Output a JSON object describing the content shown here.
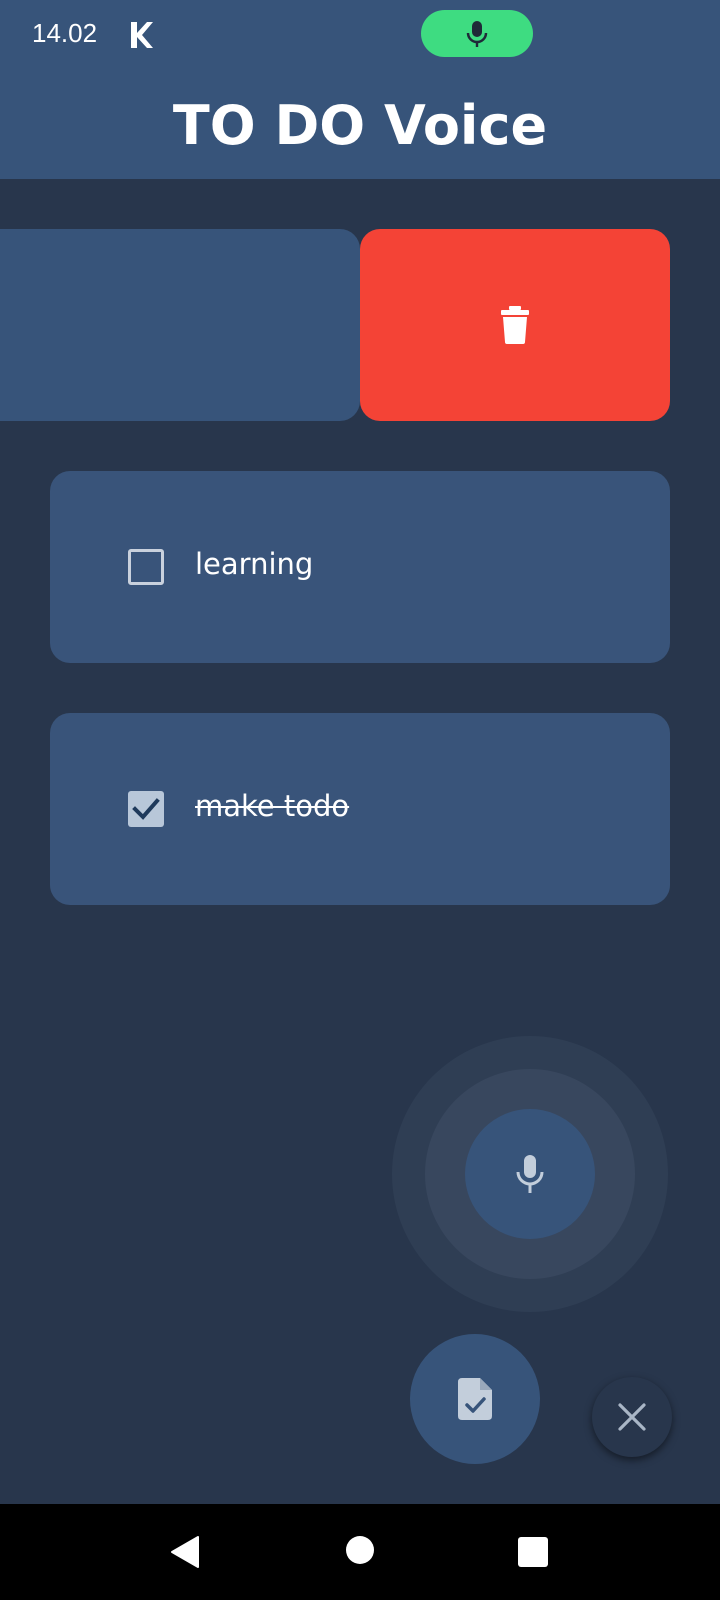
{
  "status_bar": {
    "time": "14.02"
  },
  "header": {
    "title": "TO DO Voice"
  },
  "todos": [
    {
      "text": "learning",
      "checked": false
    },
    {
      "text": "make todo",
      "checked": true
    }
  ],
  "colors": {
    "primary": "#37547a",
    "background": "#28364c",
    "delete": "#f44336",
    "mic_indicator": "#3edc81"
  },
  "icons": {
    "status_app": "k-icon",
    "mic_indicator": "mic-icon",
    "delete": "trash-icon",
    "voice_button": "mic-icon",
    "save_button": "document-check-icon",
    "close_button": "close-icon"
  }
}
